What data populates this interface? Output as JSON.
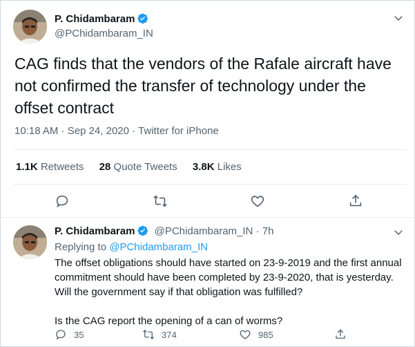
{
  "tweet": {
    "author_name": "P. Chidambaram",
    "author_handle": "@PChidambaram_IN",
    "text": "CAG finds that the vendors of the Rafale aircraft have not confirmed the transfer of technology under the offset contract",
    "time": "10:18 AM",
    "separator": " · ",
    "date": "Sep 24, 2020",
    "source": "Twitter for iPhone",
    "retweets_count": "1.1K",
    "retweets_label": "Retweets",
    "quotes_count": "28",
    "quotes_label": "Quote Tweets",
    "likes_count": "3.8K",
    "likes_label": "Likes"
  },
  "reply": {
    "author_name": "P. Chidambaram",
    "author_handle": "@PChidambaram_IN",
    "age": "· 7h",
    "replying_prefix": "Replying to",
    "replying_to": "@PChidambaram_IN",
    "paragraph1": "The offset obligations should have started on 23-9-2019 and the first annual commitment should have been completed by 23-9-2020, that is yesterday. Will the government say if that obligation was fulfilled?",
    "paragraph2": "Is the CAG report the opening of a can of worms?",
    "replies_count": "35",
    "retweets_count": "374",
    "likes_count": "985"
  },
  "icons": {
    "verified": "verified-badge-icon",
    "chevron": "chevron-down-icon",
    "reply": "reply-icon",
    "retweet": "retweet-icon",
    "like": "heart-icon",
    "share": "share-icon"
  },
  "colors": {
    "accent": "#1d9bf0",
    "text": "#0f1419",
    "muted": "#536471",
    "border": "#cfd9de"
  }
}
